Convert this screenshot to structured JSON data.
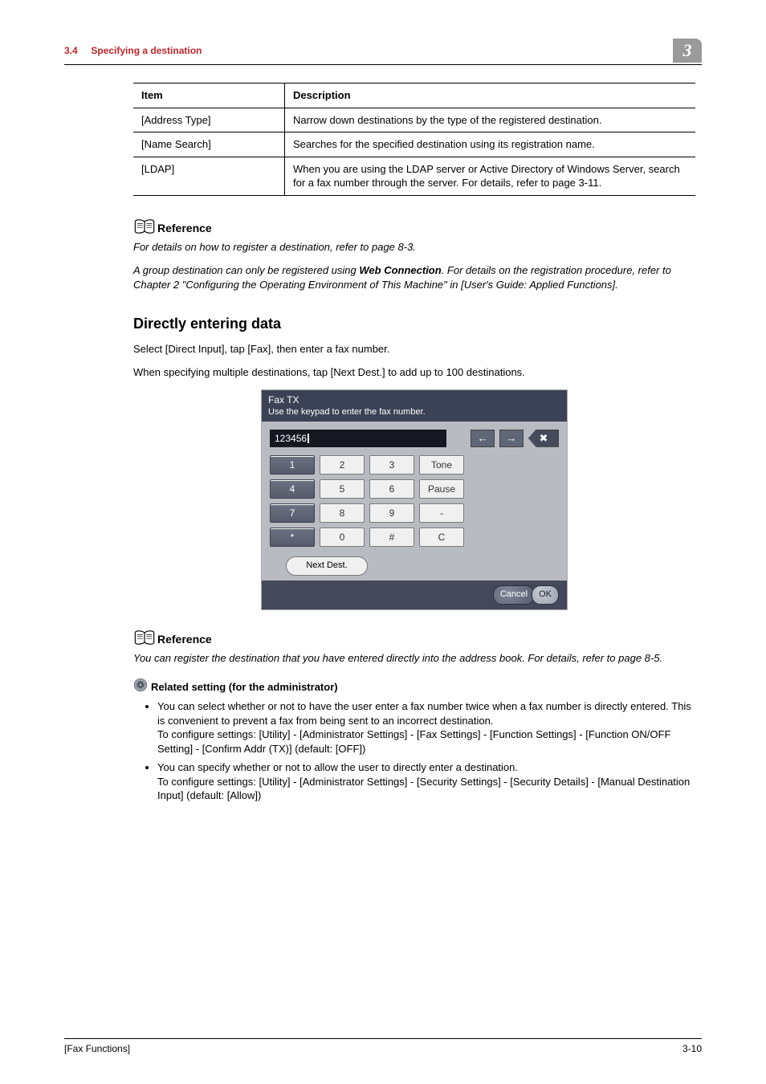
{
  "header": {
    "section_num": "3.4",
    "section_title": "Specifying a destination",
    "chapter_num": "3"
  },
  "def_table": {
    "head_item": "Item",
    "head_desc": "Description",
    "rows": [
      {
        "item": "[Address Type]",
        "desc": "Narrow down destinations by the type of the registered destination."
      },
      {
        "item": "[Name Search]",
        "desc": "Searches for the specified destination using its registration name."
      },
      {
        "item": "[LDAP]",
        "desc": "When you are using the LDAP server or Active Directory of Windows Server, search for a fax number through the server. For details, refer to page 3-11."
      }
    ]
  },
  "ref1": {
    "heading": "Reference",
    "line1": "For details on how to register a destination, refer to page 8-3.",
    "line2a": "A group destination can only be registered using ",
    "line2b_bold": "Web Connection",
    "line2c": ". For details on the registration procedure, refer to Chapter 2 \"Configuring the Operating Environment of This Machine\" in [User's Guide: Applied Functions]."
  },
  "direct": {
    "heading": "Directly entering data",
    "p1": "Select [Direct Input], tap [Fax], then enter a fax number.",
    "p2": "When specifying multiple destinations, tap [Next Dest.] to add up to 100 destinations."
  },
  "keypad": {
    "title1": "Fax TX",
    "title2": "Use the keypad to enter the fax number.",
    "input_value": "123456",
    "op_left": "←",
    "op_right": "→",
    "op_delete": "✖",
    "keys": [
      {
        "v": "1",
        "dark": true
      },
      {
        "v": "2",
        "dark": false
      },
      {
        "v": "3",
        "dark": false
      },
      {
        "v": "Tone",
        "dark": false
      },
      {
        "v": "4",
        "dark": true
      },
      {
        "v": "5",
        "dark": false
      },
      {
        "v": "6",
        "dark": false
      },
      {
        "v": "Pause",
        "dark": false
      },
      {
        "v": "7",
        "dark": true
      },
      {
        "v": "8",
        "dark": false
      },
      {
        "v": "9",
        "dark": false
      },
      {
        "v": "-",
        "dark": false
      },
      {
        "v": "*",
        "dark": true
      },
      {
        "v": "0",
        "dark": false
      },
      {
        "v": "#",
        "dark": false
      },
      {
        "v": "C",
        "dark": false
      }
    ],
    "next_dest": "Next Dest.",
    "cancel": "Cancel",
    "ok": "OK"
  },
  "ref2": {
    "heading": "Reference",
    "text": "You can register the destination that you have entered directly into the address book. For details, refer to page 8-5."
  },
  "relset": {
    "heading": "Related setting (for the administrator)",
    "b1": "You can select whether or not to have the user enter a fax number twice when a fax number is directly entered. This is convenient to prevent a fax from being sent to an incorrect destination.\nTo configure settings: [Utility] - [Administrator Settings] - [Fax Settings] - [Function Settings] - [Function ON/OFF Setting] - [Confirm Addr (TX)] (default: [OFF])",
    "b2": "You can specify whether or not to allow the user to directly enter a destination.\nTo configure settings: [Utility] - [Administrator Settings] - [Security Settings] - [Security Details] - [Manual Destination Input] (default: [Allow])"
  },
  "footer": {
    "left": "[Fax Functions]",
    "right": "3-10"
  }
}
